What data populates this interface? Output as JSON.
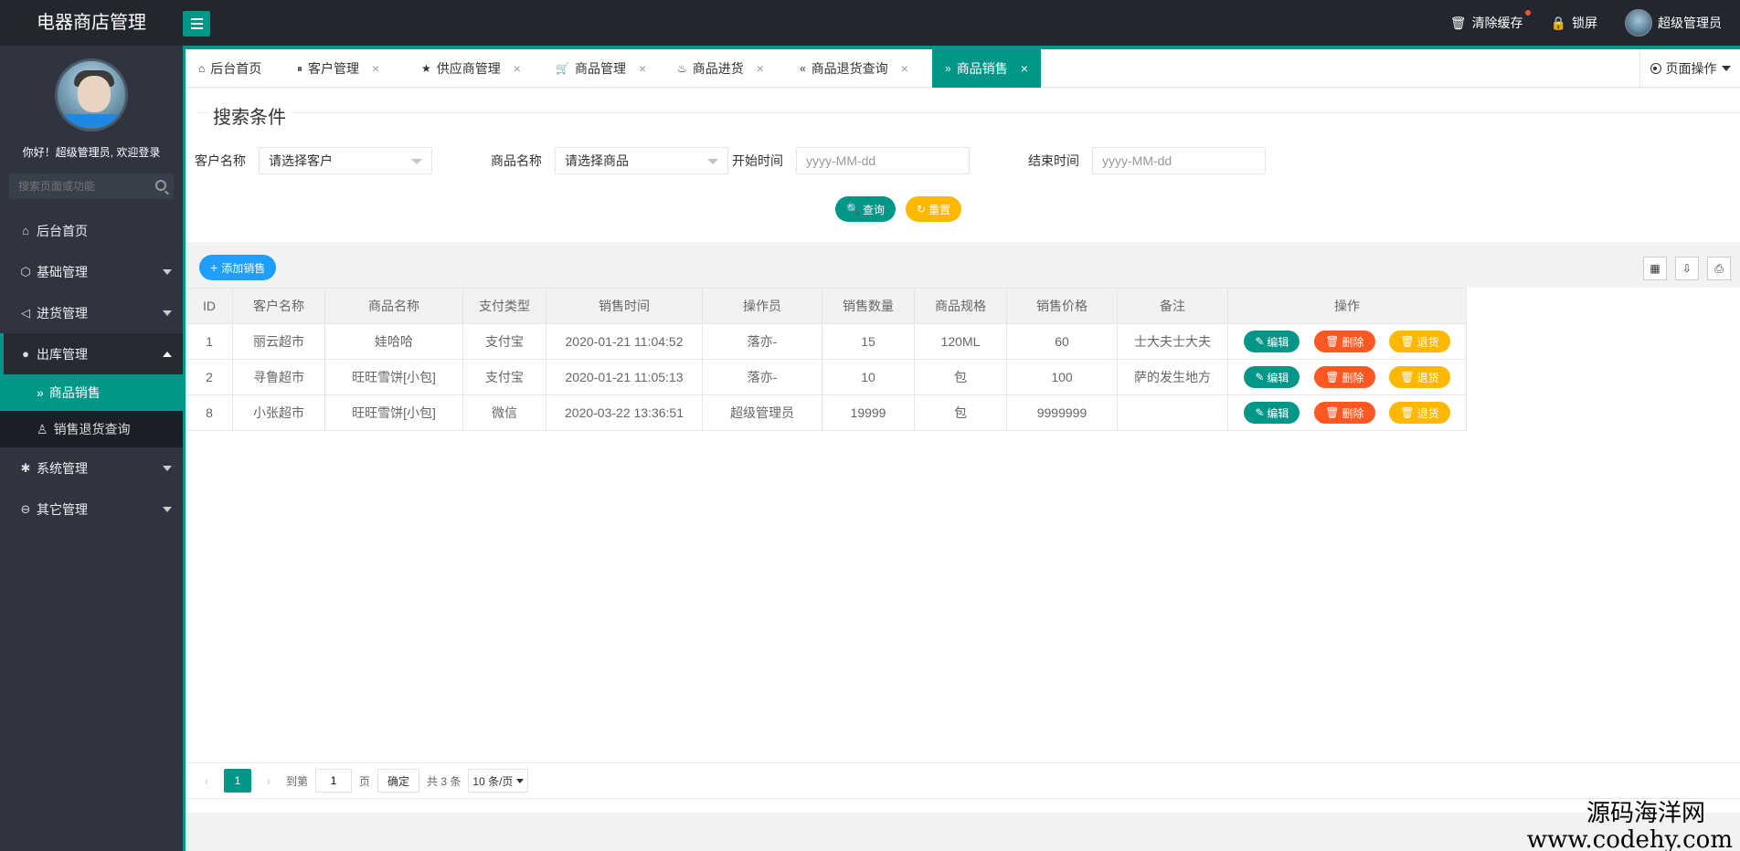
{
  "header": {
    "title": "电器商店管理",
    "clear_cache": "清除缓存",
    "lock_screen": "锁屏",
    "user": "超级管理员"
  },
  "sidebar": {
    "welcome": "你好！超级管理员, 欢迎登录",
    "search_placeholder": "搜索页面或功能",
    "items": [
      {
        "label": "后台首页"
      },
      {
        "label": "基础管理"
      },
      {
        "label": "进货管理"
      },
      {
        "label": "出库管理"
      },
      {
        "label": "系统管理"
      },
      {
        "label": "其它管理"
      }
    ],
    "sub_items": [
      {
        "label": "商品销售"
      },
      {
        "label": "销售退货查询"
      }
    ]
  },
  "tabs": [
    {
      "label": "后台首页"
    },
    {
      "label": "客户管理"
    },
    {
      "label": "供应商管理"
    },
    {
      "label": "商品管理"
    },
    {
      "label": "商品进货"
    },
    {
      "label": "商品退货查询"
    },
    {
      "label": "商品销售"
    }
  ],
  "page_op": "页面操作",
  "search": {
    "legend": "搜索条件",
    "customer_label": "客户名称",
    "customer_value": "请选择客户",
    "product_label": "商品名称",
    "product_value": "请选择商品",
    "start_label": "开始时间",
    "start_placeholder": "yyyy-MM-dd",
    "end_label": "结束时间",
    "end_placeholder": "yyyy-MM-dd",
    "query_btn": "查询",
    "reset_btn": "重置"
  },
  "toolbar": {
    "add_btn": "添加销售"
  },
  "table": {
    "headers": [
      "ID",
      "客户名称",
      "商品名称",
      "支付类型",
      "销售时间",
      "操作员",
      "销售数量",
      "商品规格",
      "销售价格",
      "备注",
      "操作"
    ],
    "rows": [
      [
        "1",
        "丽云超市",
        "娃哈哈",
        "支付宝",
        "2020-01-21 11:04:52",
        "落亦-",
        "15",
        "120ML",
        "60",
        "士大夫士大夫"
      ],
      [
        "2",
        "寻鲁超市",
        "旺旺雪饼[小包]",
        "支付宝",
        "2020-01-21 11:05:13",
        "落亦-",
        "10",
        "包",
        "100",
        "萨的发生地方"
      ],
      [
        "8",
        "小张超市",
        "旺旺雪饼[小包]",
        "微信",
        "2020-03-22 13:36:51",
        "超级管理员",
        "19999",
        "包",
        "9999999",
        ""
      ]
    ],
    "actions": {
      "edit": "编辑",
      "delete": "删除",
      "return": "退货"
    }
  },
  "pager": {
    "current": "1",
    "goto": "到第",
    "goto_value": "1",
    "page": "页",
    "confirm": "确定",
    "total": "共 3 条",
    "per_page": "10 条/页"
  },
  "watermark": {
    "line1": "源码海洋网",
    "line2": "www.codehy.com"
  }
}
